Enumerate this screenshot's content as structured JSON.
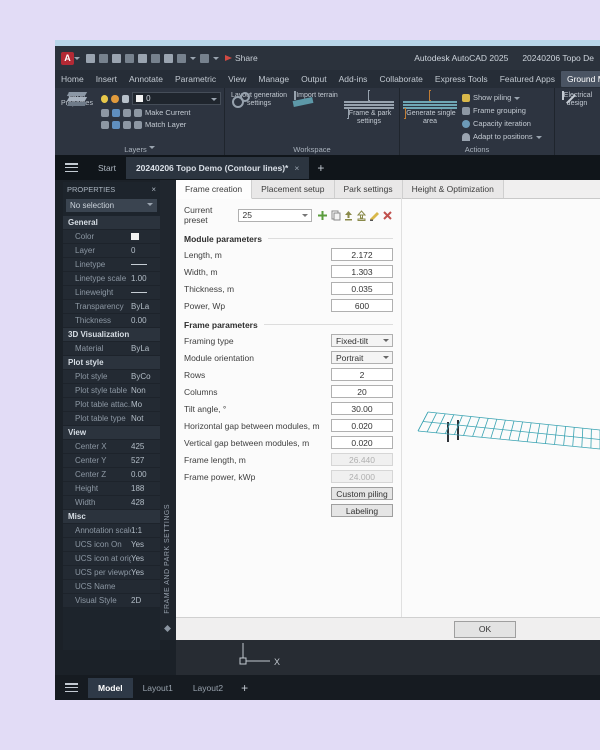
{
  "window": {
    "app_title": "Autodesk AutoCAD 2025",
    "doc_title": "20240206 Topo De",
    "share_label": "Share"
  },
  "ribbon": {
    "tabs": [
      {
        "label": "Home"
      },
      {
        "label": "Insert"
      },
      {
        "label": "Annotate"
      },
      {
        "label": "Parametric"
      },
      {
        "label": "View"
      },
      {
        "label": "Manage"
      },
      {
        "label": "Output"
      },
      {
        "label": "Add-ins"
      },
      {
        "label": "Collaborate"
      },
      {
        "label": "Express Tools"
      },
      {
        "label": "Featured Apps"
      },
      {
        "label": "Ground Mount",
        "cls": "active"
      }
    ],
    "layers_panel": {
      "big_button": "Layer Properties",
      "layer_value": "0",
      "make_current": "Make Current",
      "match_layer": "Match Layer",
      "footer": "Layers"
    },
    "workspace_panel": {
      "items": [
        {
          "label": "Layout generation settings",
          "icon": "gears-icon"
        },
        {
          "label": "Import terrain",
          "icon": "terrain-icon"
        },
        {
          "label": "Frame & park settings",
          "icon": "settings-list-icon"
        }
      ],
      "footer": "Workspace"
    },
    "actions_panel": {
      "big_button": "Generate single area",
      "items": [
        {
          "label": "Show piling",
          "cls": "hascaret",
          "icon": "piling-icon"
        },
        {
          "label": "Frame grouping",
          "icon": "grouping-icon"
        },
        {
          "label": "Capacity iteration",
          "icon": "iteration-icon"
        },
        {
          "label": "Adapt to positions",
          "cls": "hascaret",
          "icon": "adapt-icon"
        }
      ],
      "footer": "Actions"
    },
    "electrical_button": "Electrical design"
  },
  "file_tabs": {
    "start": "Start",
    "document": "20240206 Topo Demo (Contour lines)*",
    "close_glyph": "×",
    "add_label": "+"
  },
  "properties": {
    "title": "PROPERTIES",
    "close_glyph": "×",
    "selector": "No selection",
    "rows": [
      {
        "cls": "section",
        "label": "General",
        "value": ""
      },
      {
        "cls": "swatch",
        "label": "Color",
        "value": ""
      },
      {
        "label": "Layer",
        "value": "0"
      },
      {
        "cls": "lineglyph",
        "label": "Linetype",
        "value": ""
      },
      {
        "label": "Linetype scale",
        "value": "1.00"
      },
      {
        "cls": "lineglyph",
        "label": "Lineweight",
        "value": ""
      },
      {
        "label": "Transparency",
        "value": "ByLa"
      },
      {
        "label": "Thickness",
        "value": "0.00"
      },
      {
        "cls": "section",
        "label": "3D Visualization",
        "value": ""
      },
      {
        "label": "Material",
        "value": "ByLa"
      },
      {
        "cls": "section",
        "label": "Plot style",
        "value": ""
      },
      {
        "label": "Plot style",
        "value": "ByCo"
      },
      {
        "label": "Plot style table",
        "value": "Non"
      },
      {
        "label": "Plot table attac...",
        "value": "Mo"
      },
      {
        "label": "Plot table type",
        "value": "Not"
      },
      {
        "cls": "section",
        "label": "View",
        "value": ""
      },
      {
        "label": "Center X",
        "value": "425"
      },
      {
        "label": "Center Y",
        "value": "527"
      },
      {
        "label": "Center Z",
        "value": "0.00"
      },
      {
        "label": "Height",
        "value": "188"
      },
      {
        "label": "Width",
        "value": "428"
      },
      {
        "cls": "section",
        "label": "Misc",
        "value": ""
      },
      {
        "label": "Annotation scale",
        "value": "1:1"
      },
      {
        "label": "UCS icon On",
        "value": "Yes"
      },
      {
        "label": "UCS icon at orig...",
        "value": "Yes"
      },
      {
        "label": "UCS per viewport",
        "value": "Yes"
      },
      {
        "label": "UCS Name",
        "value": ""
      },
      {
        "label": "Visual Style",
        "value": "2D"
      }
    ]
  },
  "dialog": {
    "strip_title": "FRAME AND PARK SETTINGS",
    "tabs": [
      {
        "label": "Frame creation",
        "cls": "active"
      },
      {
        "label": "Placement setup"
      },
      {
        "label": "Park settings"
      },
      {
        "label": "Height & Optimization"
      }
    ],
    "preset": {
      "label": "Current preset",
      "value": "25",
      "icons": [
        "add-preset-icon",
        "copy-preset-icon",
        "import-preset-icon",
        "export-preset-icon",
        "rename-preset-icon",
        "delete-preset-icon"
      ]
    },
    "rows": [
      {
        "cls": "group",
        "label": "Module parameters",
        "value": ""
      },
      {
        "label": "Length, m",
        "value": "2.172"
      },
      {
        "label": "Width, m",
        "value": "1.303"
      },
      {
        "label": "Thickness, m",
        "value": "0.035"
      },
      {
        "label": "Power, Wp",
        "value": "600"
      },
      {
        "cls": "group",
        "label": "Frame parameters",
        "value": ""
      },
      {
        "cls": "select",
        "label": "Framing type",
        "value": "Fixed-tilt"
      },
      {
        "cls": "select",
        "label": "Module orientation",
        "value": "Portrait"
      },
      {
        "label": "Rows",
        "value": "2"
      },
      {
        "label": "Columns",
        "value": "20"
      },
      {
        "label": "Tilt angle, °",
        "value": "30.00"
      },
      {
        "label": "Horizontal gap between modules, m",
        "value": "0.020"
      },
      {
        "label": "Vertical gap between modules, m",
        "value": "0.020"
      },
      {
        "cls": "disabled",
        "label": "Frame length, m",
        "value": "26.440"
      },
      {
        "cls": "disabled",
        "label": "Frame power, kWp",
        "value": "24.000"
      },
      {
        "cls": "button",
        "label": "",
        "value": "Custom piling"
      },
      {
        "cls": "button",
        "label": "",
        "value": "Labeling"
      }
    ],
    "ok_label": "OK",
    "preview": {
      "columns": 20,
      "rows": 2,
      "frame_color": "#3aa3b2",
      "pile_color": "#2d3238"
    }
  },
  "canvas": {
    "ucs_x_label": "X"
  },
  "model_bar": {
    "tabs": [
      {
        "label": "Model",
        "cls": "active"
      },
      {
        "label": "Layout1"
      },
      {
        "label": "Layout2"
      }
    ],
    "add_label": "+"
  }
}
